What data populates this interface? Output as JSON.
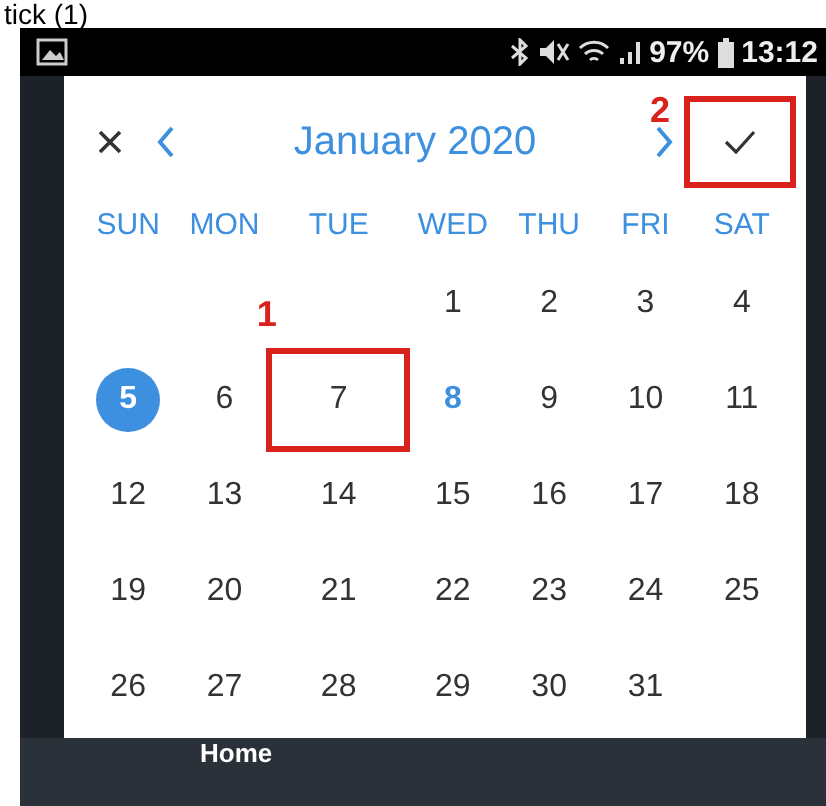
{
  "caption": "tick (1)",
  "status_bar": {
    "battery": "97%",
    "time": "13:12"
  },
  "dialog": {
    "title": "January 2020",
    "confirm_callout": "2",
    "weekdays": [
      "SUN",
      "MON",
      "TUE",
      "WED",
      "THU",
      "FRI",
      "SAT"
    ],
    "weeks": [
      [
        {
          "day": "1",
          "selected": false,
          "today": false
        },
        {
          "day": "2",
          "selected": false,
          "today": false
        },
        {
          "day": "3",
          "selected": false,
          "today": false
        },
        {
          "day": "4",
          "selected": false,
          "today": false
        }
      ],
      [
        {
          "day": "5",
          "selected": true,
          "today": false
        },
        {
          "day": "6",
          "selected": false,
          "today": false
        },
        {
          "day": "7",
          "selected": false,
          "today": false,
          "callout": "1"
        },
        {
          "day": "8",
          "selected": false,
          "today": true
        },
        {
          "day": "9",
          "selected": false,
          "today": false
        },
        {
          "day": "10",
          "selected": false,
          "today": false
        },
        {
          "day": "11",
          "selected": false,
          "today": false
        }
      ],
      [
        {
          "day": "12",
          "selected": false,
          "today": false
        },
        {
          "day": "13",
          "selected": false,
          "today": false
        },
        {
          "day": "14",
          "selected": false,
          "today": false
        },
        {
          "day": "15",
          "selected": false,
          "today": false
        },
        {
          "day": "16",
          "selected": false,
          "today": false
        },
        {
          "day": "17",
          "selected": false,
          "today": false
        },
        {
          "day": "18",
          "selected": false,
          "today": false
        }
      ],
      [
        {
          "day": "19",
          "selected": false,
          "today": false
        },
        {
          "day": "20",
          "selected": false,
          "today": false
        },
        {
          "day": "21",
          "selected": false,
          "today": false
        },
        {
          "day": "22",
          "selected": false,
          "today": false
        },
        {
          "day": "23",
          "selected": false,
          "today": false
        },
        {
          "day": "24",
          "selected": false,
          "today": false
        },
        {
          "day": "25",
          "selected": false,
          "today": false
        }
      ],
      [
        {
          "day": "26",
          "selected": false,
          "today": false
        },
        {
          "day": "27",
          "selected": false,
          "today": false
        },
        {
          "day": "28",
          "selected": false,
          "today": false
        },
        {
          "day": "29",
          "selected": false,
          "today": false
        },
        {
          "day": "30",
          "selected": false,
          "today": false
        },
        {
          "day": "31",
          "selected": false,
          "today": false
        }
      ]
    ]
  },
  "bottom_nav": {
    "label": "Home"
  }
}
